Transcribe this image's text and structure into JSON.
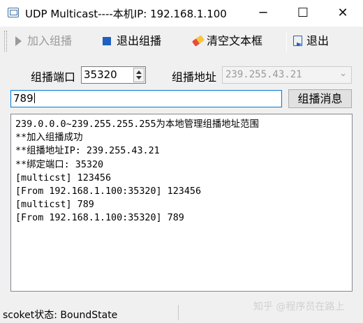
{
  "window": {
    "title": "UDP Multicast----本机IP: 192.168.1.100",
    "minimize_glyph": "─",
    "maximize_glyph": "☐",
    "close_glyph": "✕"
  },
  "toolbar": {
    "join_label": "加入组播",
    "leave_label": "退出组播",
    "clear_label": "清空文本框",
    "exit_label": "退出"
  },
  "form": {
    "port_label": "组播端口",
    "port_value": "35320",
    "address_label": "组播地址",
    "address_value": "239.255.43.21",
    "message_value": "789",
    "send_label": "组播消息"
  },
  "log": {
    "lines": [
      "239.0.0.0~239.255.255.255为本地管理组播地址范围",
      "**加入组播成功",
      "**组播地址IP: 239.255.43.21",
      "**绑定端口: 35320",
      "[multicst] 123456",
      "[From 192.168.1.100:35320] 123456",
      "[multicst] 789",
      "[From 192.168.1.100:35320] 789"
    ]
  },
  "status": {
    "text": "scoket状态: BoundState"
  },
  "watermark": "知乎 @程序员在路上",
  "icons": {
    "app": "window-icon",
    "join": "play-icon",
    "leave": "stop-icon",
    "clear": "eraser-icon",
    "exit": "exit-door-icon"
  },
  "colors": {
    "accent": "#0078d7",
    "icon_blue": "#1f5fbf",
    "disabled_text": "#9a9a9a"
  }
}
